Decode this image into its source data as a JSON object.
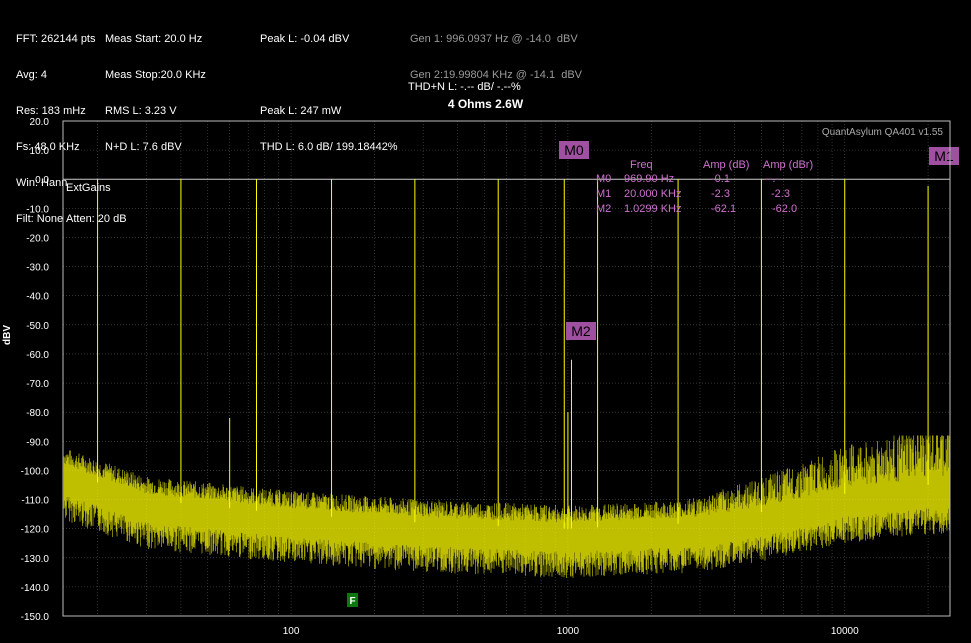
{
  "header": {
    "col1": [
      "FFT: 262144 pts",
      "Avg: 4",
      "Res: 183 mHz",
      "Fs: 48.0 KHz",
      "Win: Hann",
      "Filt: None"
    ],
    "col2": [
      "Meas Start: 20.0 Hz",
      "Meas Stop:20.0 KHz",
      "RMS L: 3.23 V",
      "N+D L: 7.6 dBV"
    ],
    "col3": [
      "Peak L: -0.04 dBV",
      "Peak L: 247 mW",
      "THD L: 6.0 dB/ 199.18442%"
    ],
    "col4": [
      "THD+N L: -.-- dB/ -.--%"
    ],
    "gen": [
      "Gen 1: 996.0937 Hz @ -14.0  dBV",
      "Gen 2:19.99804 KHz @ -14.1  dBV"
    ]
  },
  "brand": "QuantAsylum QA401 v1.55",
  "annotations": {
    "extgains": "ExtGains",
    "atten": "Atten: 20 dB",
    "f_marker": "F"
  },
  "marker_table": {
    "headers": [
      "Freq",
      "Amp (dB)",
      "Amp (dBr)"
    ],
    "rows": [
      [
        "M0",
        "969.90 Hz",
        "-0.1",
        "--.-"
      ],
      [
        "M1",
        "20.000 KHz",
        "-2.3",
        "-2.3"
      ],
      [
        "M2",
        "1.0299 KHz",
        "-62.1",
        "-62.0"
      ]
    ]
  },
  "colors": {
    "trace": "#ffff00",
    "marker_fill": "#a050a0",
    "marker_text": "#d070d0",
    "grid": "#555555",
    "background": "#000000",
    "header_gray": "#9a9a9a"
  },
  "chart_data": {
    "type": "line",
    "title": "4 Ohms 2.6W",
    "xlabel": "",
    "ylabel": "dBV",
    "xscale": "log",
    "xlim": [
      15,
      24000
    ],
    "ylim": [
      -150,
      20
    ],
    "yticks": [
      20,
      10,
      0,
      -10,
      -20,
      -30,
      -40,
      -50,
      -60,
      -70,
      -80,
      -90,
      -100,
      -110,
      -120,
      -130,
      -140,
      -150
    ],
    "ytick_labels": [
      "20.0",
      "10.0",
      "0.0",
      "-10.0",
      "-20.0",
      "-30.0",
      "-40.0",
      "-50.0",
      "-60.0",
      "-70.0",
      "-80.0",
      "-90.0",
      "-100.0",
      "-110.0",
      "-120.0",
      "-130.0",
      "-140.0",
      "-150.0"
    ],
    "xticks": [
      100,
      1000,
      10000
    ],
    "xtick_labels": [
      "100",
      "1000",
      "10000"
    ],
    "grid": true,
    "series": [
      {
        "noise_floor_db": [
          [
            15,
            -100
          ],
          [
            30,
            -110
          ],
          [
            100,
            -115
          ],
          [
            300,
            -118
          ],
          [
            1000,
            -120
          ],
          [
            3000,
            -118
          ],
          [
            6000,
            -113
          ],
          [
            10000,
            -108
          ],
          [
            20000,
            -105
          ]
        ],
        "peaks": [
          {
            "freq": 20,
            "db": 0
          },
          {
            "freq": 40,
            "db": 0
          },
          {
            "freq": 75,
            "db": 0
          },
          {
            "freq": 140,
            "db": 0
          },
          {
            "freq": 280,
            "db": 0
          },
          {
            "freq": 560,
            "db": 0
          },
          {
            "freq": 970,
            "db": 0
          },
          {
            "freq": 1280,
            "db": 0
          },
          {
            "freq": 2500,
            "db": 0
          },
          {
            "freq": 5000,
            "db": 0
          },
          {
            "freq": 10000,
            "db": 0
          },
          {
            "freq": 20000,
            "db": -2.3
          },
          {
            "freq": 1030,
            "db": -62
          },
          {
            "freq": 1000,
            "db": -80
          },
          {
            "freq": 60,
            "db": -82
          }
        ]
      }
    ],
    "markers": [
      {
        "label": "M0",
        "freq": 969.9,
        "db": -0.1
      },
      {
        "label": "M1",
        "freq": 20000,
        "db": -2.3
      },
      {
        "label": "M2",
        "freq": 1029.9,
        "db": -62.1
      }
    ]
  }
}
